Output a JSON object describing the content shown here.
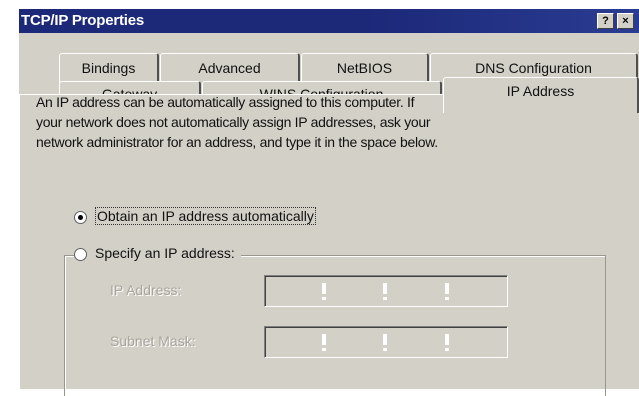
{
  "window": {
    "title": "TCP/IP Properties",
    "help_button": "?",
    "close_button": "×"
  },
  "tabs": {
    "row1": [
      "Bindings",
      "Advanced",
      "NetBIOS",
      "DNS Configuration"
    ],
    "row2": [
      "Gateway",
      "WINS Configuration",
      "IP Address"
    ],
    "selected": "IP Address"
  },
  "ip_page": {
    "description_lines": [
      "An IP address can be automatically assigned to this computer. If",
      "your network does not automatically assign IP addresses, ask your",
      "network administrator for an address, and type it in the space below."
    ],
    "option_auto": "Obtain an IP address automatically",
    "option_auto_selected": true,
    "option_specify": "Specify an IP address:",
    "option_specify_selected": false,
    "ip_address_label": "IP Address:",
    "subnet_mask_label": "Subnet Mask:",
    "ip_address_value": "",
    "subnet_mask_value": ""
  },
  "colors": {
    "titlebar": "#1c2878",
    "dialog_face": "#d3d0c8"
  }
}
